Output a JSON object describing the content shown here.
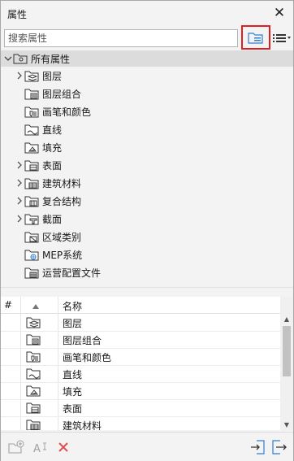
{
  "window": {
    "title": "属性"
  },
  "search": {
    "placeholder": "搜索属性",
    "value": ""
  },
  "tree": {
    "root": {
      "label": "所有属性",
      "icon": "all-attributes-folder-icon"
    },
    "items": [
      {
        "label": "图层",
        "expandable": true,
        "icon": "layers-icon"
      },
      {
        "label": "图层组合",
        "expandable": false,
        "icon": "layer-combination-icon"
      },
      {
        "label": "画笔和颜色",
        "expandable": false,
        "icon": "pen-color-icon"
      },
      {
        "label": "直线",
        "expandable": false,
        "icon": "line-type-icon"
      },
      {
        "label": "填充",
        "expandable": false,
        "icon": "fill-icon"
      },
      {
        "label": "表面",
        "expandable": true,
        "icon": "surface-icon"
      },
      {
        "label": "建筑材料",
        "expandable": true,
        "icon": "building-material-icon"
      },
      {
        "label": "复合结构",
        "expandable": true,
        "icon": "composite-structure-icon"
      },
      {
        "label": "截面",
        "expandable": true,
        "icon": "profile-icon"
      },
      {
        "label": "区域类别",
        "expandable": false,
        "icon": "zone-category-icon"
      },
      {
        "label": "MEP系统",
        "expandable": false,
        "icon": "mep-system-icon"
      },
      {
        "label": "运营配置文件",
        "expandable": false,
        "icon": "operation-profile-icon"
      }
    ]
  },
  "table": {
    "columns": {
      "index": "#",
      "name": "名称"
    },
    "rows": [
      {
        "name": "图层",
        "icon": "layers-icon"
      },
      {
        "name": "图层组合",
        "icon": "layer-combination-icon"
      },
      {
        "name": "画笔和颜色",
        "icon": "pen-color-icon"
      },
      {
        "name": "直线",
        "icon": "line-type-icon"
      },
      {
        "name": "填充",
        "icon": "fill-icon"
      },
      {
        "name": "表面",
        "icon": "surface-icon"
      },
      {
        "name": "建筑材料",
        "icon": "building-material-icon"
      }
    ]
  },
  "colors": {
    "highlight_border": "#e02020",
    "accent_blue": "#2f7fd0",
    "delete_red": "#e05050"
  }
}
